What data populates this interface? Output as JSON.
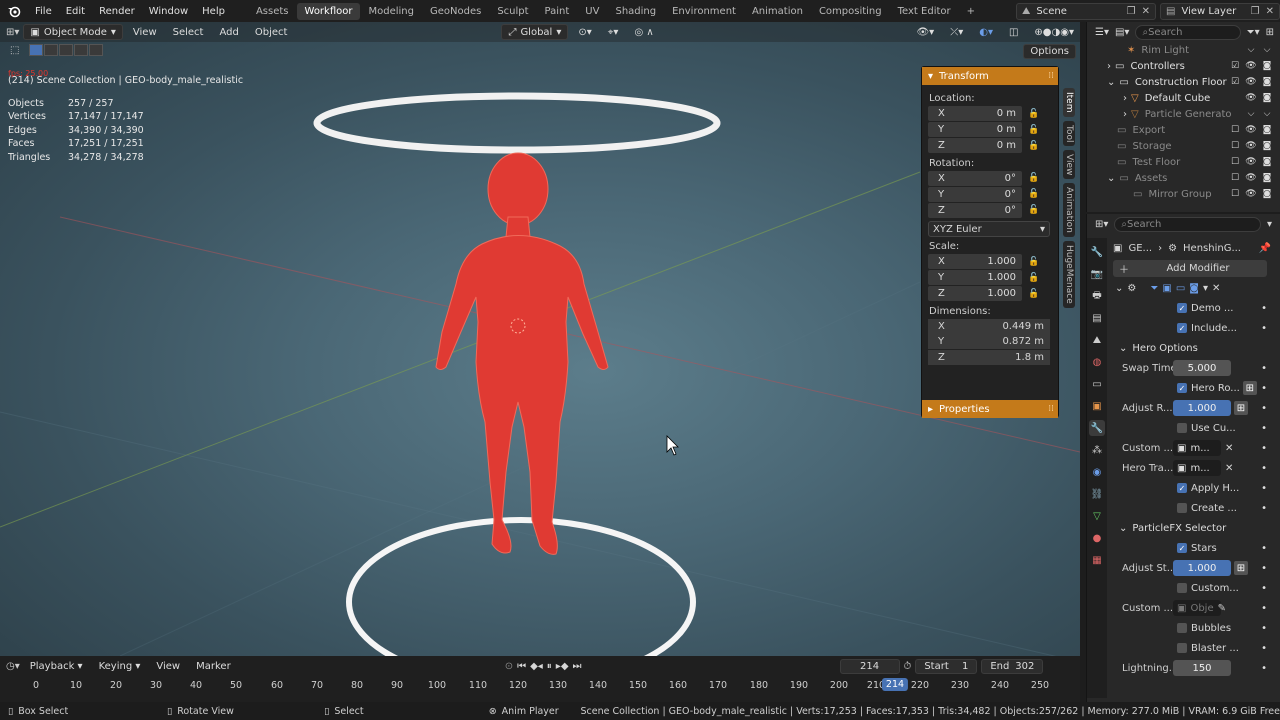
{
  "menubar": {
    "menus": [
      "File",
      "Edit",
      "Render",
      "Window",
      "Help"
    ],
    "workspaces": [
      "Assets",
      "Workfloor",
      "Modeling",
      "GeoNodes",
      "Sculpt",
      "Paint",
      "UV",
      "Shading",
      "Environment",
      "Animation",
      "Compositing",
      "Text Editor"
    ],
    "active_workspace": "Workfloor",
    "add_tab": "+",
    "scene": "Scene",
    "view_layer": "View Layer"
  },
  "viewport": {
    "mode": "Object Mode",
    "menus": [
      "View",
      "Select",
      "Add",
      "Object"
    ],
    "transform_orientation": "Global",
    "options": "Options",
    "fps": "fps: 25.00",
    "collection_path": "(214) Scene Collection | GEO-body_male_realistic",
    "stats": [
      {
        "label": "Objects",
        "value": "257 / 257"
      },
      {
        "label": "Vertices",
        "value": "17,147 / 17,147"
      },
      {
        "label": "Edges",
        "value": "34,390 / 34,390"
      },
      {
        "label": "Faces",
        "value": "17,251 / 17,251"
      },
      {
        "label": "Triangles",
        "value": "34,278 / 34,278"
      }
    ]
  },
  "npanel": {
    "title": "Transform",
    "location_label": "Location:",
    "location": [
      {
        "axis": "X",
        "value": "0 m"
      },
      {
        "axis": "Y",
        "value": "0 m"
      },
      {
        "axis": "Z",
        "value": "0 m"
      }
    ],
    "rotation_label": "Rotation:",
    "rotation": [
      {
        "axis": "X",
        "value": "0°"
      },
      {
        "axis": "Y",
        "value": "0°"
      },
      {
        "axis": "Z",
        "value": "0°"
      }
    ],
    "rotation_mode": "XYZ Euler",
    "scale_label": "Scale:",
    "scale": [
      {
        "axis": "X",
        "value": "1.000"
      },
      {
        "axis": "Y",
        "value": "1.000"
      },
      {
        "axis": "Z",
        "value": "1.000"
      }
    ],
    "dimensions_label": "Dimensions:",
    "dimensions": [
      {
        "axis": "X",
        "value": "0.449 m"
      },
      {
        "axis": "Y",
        "value": "0.872 m"
      },
      {
        "axis": "Z",
        "value": "1.8 m"
      }
    ],
    "properties": "Properties",
    "side_tabs": [
      "Item",
      "Tool",
      "View",
      "Animation",
      "HugeMenace"
    ]
  },
  "timeline": {
    "menus": [
      "Playback",
      "Keying",
      "View",
      "Marker"
    ],
    "current_frame": "214",
    "start_label": "Start",
    "start": "1",
    "end_label": "End",
    "end": "302",
    "ticks": [
      "0",
      "10",
      "20",
      "30",
      "40",
      "50",
      "60",
      "70",
      "80",
      "90",
      "100",
      "110",
      "120",
      "130",
      "140",
      "150",
      "160",
      "170",
      "180",
      "190",
      "200",
      "210",
      "220",
      "230",
      "240",
      "250"
    ]
  },
  "statusbar": {
    "box_select": "Box Select",
    "rotate_view": "Rotate View",
    "select": "Select",
    "anim_player": "Anim Player",
    "info": "Scene Collection | GEO-body_male_realistic | Verts:17,253 | Faces:17,353 | Tris:34,482 | Objects:257/262 | Memory: 277.0 MiB | VRAM: 6.9 GiB Free"
  },
  "outliner": {
    "search_placeholder": "Search",
    "rows": [
      {
        "name": "Rim Light",
        "dim": true
      },
      {
        "name": "Controllers",
        "dim": false
      },
      {
        "name": "Construction Floor",
        "dim": false
      },
      {
        "name": "Default Cube",
        "dim": false
      },
      {
        "name": "Particle Generato",
        "dim": true
      },
      {
        "name": "Export",
        "dim": true
      },
      {
        "name": "Storage",
        "dim": true
      },
      {
        "name": "Test Floor",
        "dim": true
      },
      {
        "name": "Assets",
        "dim": true
      },
      {
        "name": "Mirror Group",
        "dim": true
      }
    ]
  },
  "properties": {
    "search_placeholder": "Search",
    "breadcrumb_obj": "GE...",
    "breadcrumb_mod": "HenshinG...",
    "add_modifier": "Add Modifier",
    "demo": "Demo ...",
    "include": "Include...",
    "hero_options": "Hero Options",
    "swap_time_label": "Swap Time",
    "swap_time": "5.000",
    "hero_ro": "Hero Ro...",
    "adjust_r_label": "Adjust R...",
    "adjust_r": "1.000",
    "use_cu": "Use Cu...",
    "custom_label": "Custom ...",
    "custom_val": "m...",
    "hero_tra_label": "Hero Tra...",
    "hero_tra_val": "m...",
    "apply_h": "Apply H...",
    "create": "Create ...",
    "particlefx": "ParticleFX Selector",
    "stars": "Stars",
    "adjust_st_label": "Adjust St...",
    "adjust_st": "1.000",
    "custom2": "Custom...",
    "custom3_label": "Custom ...",
    "custom3_val": "Obje",
    "bubbles": "Bubbles",
    "blaster": "Blaster ...",
    "lightning_label": "Lightning...",
    "lightning": "150"
  }
}
